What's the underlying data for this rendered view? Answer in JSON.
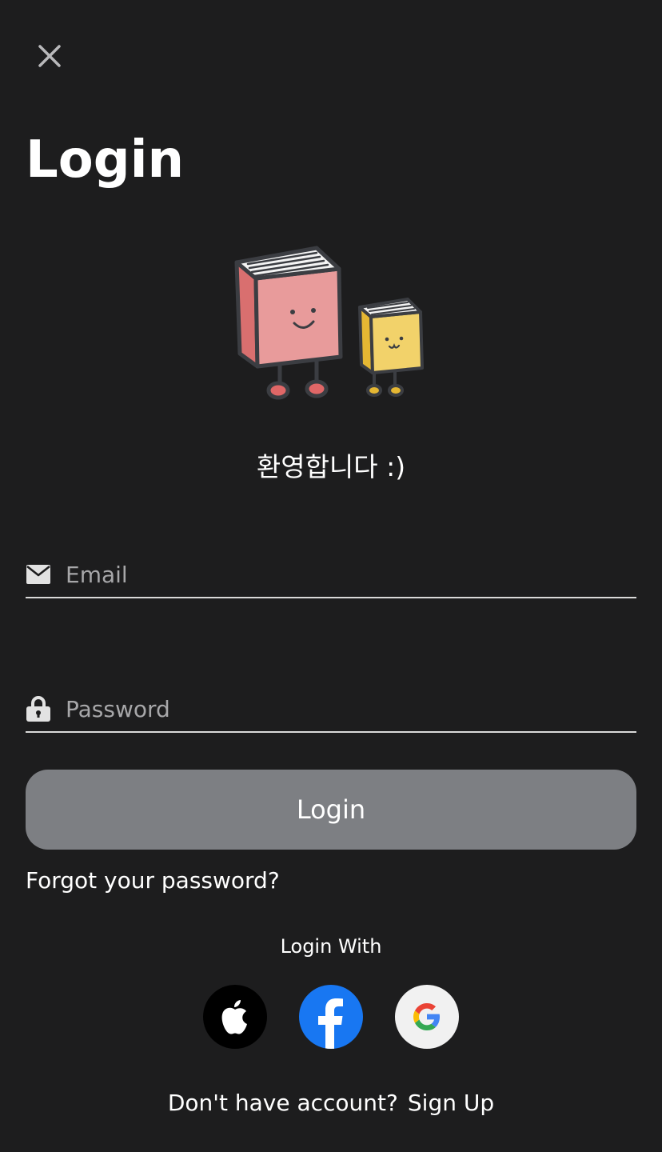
{
  "title": "Login",
  "welcome": "환영합니다 :)",
  "email": {
    "placeholder": "Email",
    "value": ""
  },
  "password": {
    "placeholder": "Password",
    "value": ""
  },
  "login_button": "Login",
  "forgot_password": "Forgot your password?",
  "login_with": "Login With",
  "social_icons": [
    "apple-icon",
    "facebook-icon",
    "google-icon"
  ],
  "no_account": "Don't have account?",
  "sign_up": "Sign Up",
  "colors": {
    "background": "#1d1d1e",
    "button": "#7d7f83",
    "facebook": "#1877f2",
    "book_pink": "#e89b9b",
    "book_yellow": "#f2d26a"
  }
}
